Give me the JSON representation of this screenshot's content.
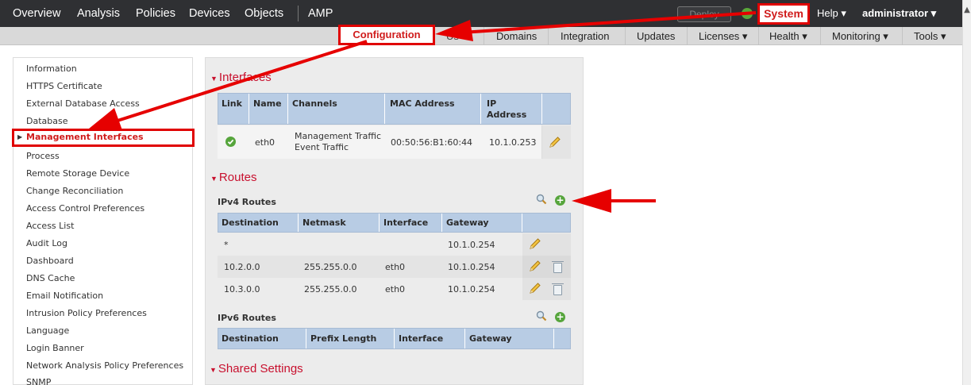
{
  "topnav": {
    "items": [
      "Overview",
      "Analysis",
      "Policies",
      "Devices",
      "Objects",
      "AMP"
    ],
    "deploy_label": "Deploy",
    "system_label": "System",
    "help_label": "Help ▾",
    "user_label": "administrator ▾"
  },
  "subnav": {
    "active_label": "Configuration",
    "hidden_label": "Us",
    "items": [
      "Domains",
      "Integration",
      "Updates",
      "Licenses ▾",
      "Health ▾",
      "Monitoring ▾",
      "Tools ▾"
    ]
  },
  "sidebar": {
    "items": [
      "Information",
      "HTTPS Certificate",
      "External Database Access",
      "Database",
      "Management Interfaces",
      "Process",
      "Remote Storage Device",
      "Change Reconciliation",
      "Access Control Preferences",
      "Access List",
      "Audit Log",
      "Dashboard",
      "DNS Cache",
      "Email Notification",
      "Intrusion Policy Preferences",
      "Language",
      "Login Banner",
      "Network Analysis Policy Preferences",
      "SNMP"
    ],
    "active_index": 4
  },
  "interfaces": {
    "title": "Interfaces",
    "headers": [
      "Link",
      "Name",
      "Channels",
      "MAC Address",
      "IP",
      "Address"
    ],
    "row": {
      "name": "eth0",
      "channel1": "Management Traffic",
      "channel2": "Event Traffic",
      "mac": "00:50:56:B1:60:44",
      "ip": "10.1.0.253"
    }
  },
  "routes": {
    "title": "Routes",
    "ipv4_title": "IPv4 Routes",
    "ipv4_headers": [
      "Destination",
      "Netmask",
      "Interface",
      "Gateway"
    ],
    "ipv4_rows": [
      {
        "destination": "*",
        "netmask": "",
        "interface": "",
        "gateway": "10.1.0.254"
      },
      {
        "destination": "10.2.0.0",
        "netmask": "255.255.0.0",
        "interface": "eth0",
        "gateway": "10.1.0.254"
      },
      {
        "destination": "10.3.0.0",
        "netmask": "255.255.0.0",
        "interface": "eth0",
        "gateway": "10.1.0.254"
      }
    ],
    "ipv6_title": "IPv6 Routes",
    "ipv6_headers": [
      "Destination",
      "Prefix Length",
      "Interface",
      "Gateway"
    ]
  },
  "shared": {
    "title": "Shared Settings"
  },
  "colors": {
    "accent": "#c8102e",
    "highlight": "#e00000",
    "table_header": "#b8cce4",
    "topbar": "#2f3033"
  }
}
